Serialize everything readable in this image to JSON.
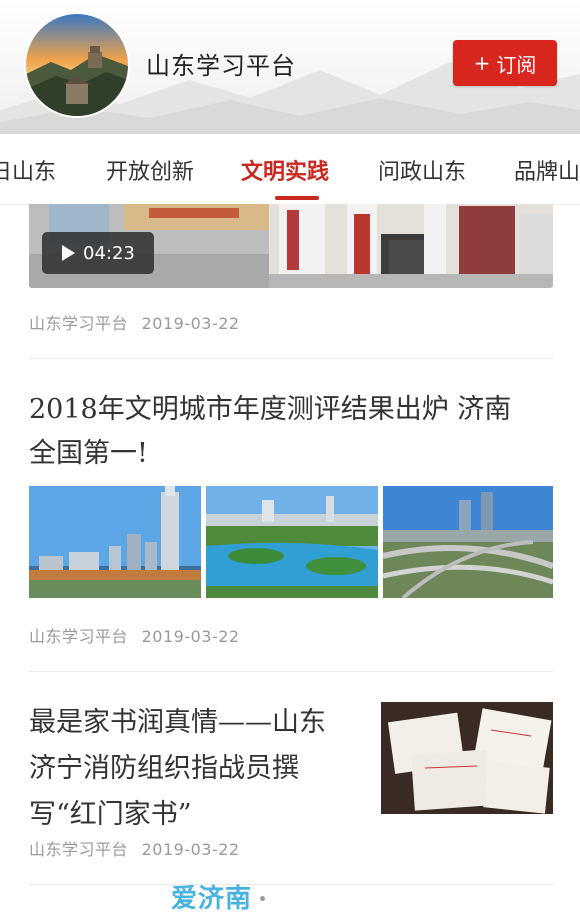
{
  "header": {
    "title": "山东学习平台",
    "subscribe_label": "订阅",
    "subscribe_plus": "+"
  },
  "tabs": [
    {
      "label": "日山东"
    },
    {
      "label": "开放创新"
    },
    {
      "label": "文明实践",
      "active": true
    },
    {
      "label": "问政山东"
    },
    {
      "label": "品牌山"
    }
  ],
  "articles": [
    {
      "source": "山东学习平台",
      "date": "2019-03-22",
      "video_duration": "04:23"
    },
    {
      "title_line1": "2018年文明城市年度测评结果出炉  济南",
      "title_line2": "全国第一!",
      "source": "山东学习平台",
      "date": "2019-03-22"
    },
    {
      "title_line1": "最是家书润真情——山东",
      "title_line2": "济宁消防组织指战员撰",
      "title_line3": "写“红门家书”",
      "source": "山东学习平台",
      "date": "2019-03-22"
    }
  ],
  "footer": {
    "logo_text": "爱济南",
    "logo_dot": "•"
  },
  "colors": {
    "accent": "#c8281e",
    "subscribe_bg": "#d8251d",
    "meta_text": "#9a9a9a",
    "logo": "#49b3df"
  },
  "icons": {
    "play": "play-icon",
    "plus": "plus-icon"
  }
}
